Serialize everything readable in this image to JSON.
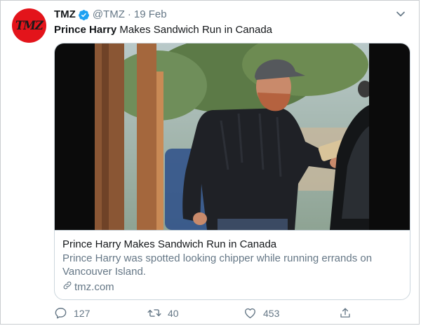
{
  "tweet": {
    "author_name": "TMZ",
    "handle": "@TMZ",
    "separator": "·",
    "date": "19 Feb",
    "text_bold": "Prince Harry",
    "text_rest": " Makes Sandwich Run in Canada",
    "avatar_logo": "TMZ"
  },
  "card": {
    "title": "Prince Harry Makes Sandwich Run in Canada",
    "description": "Prince Harry was spotted looking chipper while running errands on Vancouver Island.",
    "domain": "tmz.com",
    "link_icon": "link-icon"
  },
  "actions": {
    "replies": "127",
    "retweets": "40",
    "likes": "453",
    "icons": [
      "reply-icon",
      "retweet-icon",
      "like-icon",
      "share-icon"
    ]
  },
  "colors": {
    "verified": "#1da1f2",
    "avatar_bg": "#e3141b",
    "muted_text": "#657786",
    "primary_text": "#14171a",
    "card_border": "#ccd6dd"
  }
}
